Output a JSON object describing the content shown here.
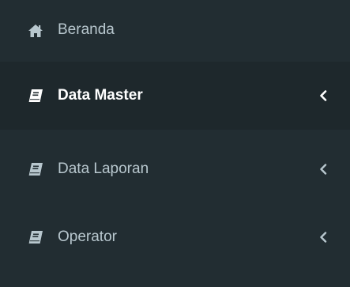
{
  "sidebar": {
    "items": [
      {
        "label": "Beranda",
        "icon": "home-icon",
        "active": false,
        "has_submenu": false
      },
      {
        "label": "Data Master",
        "icon": "book-icon",
        "active": true,
        "has_submenu": true
      },
      {
        "label": "Data Laporan",
        "icon": "book-icon",
        "active": false,
        "has_submenu": true
      },
      {
        "label": "Operator",
        "icon": "book-icon",
        "active": false,
        "has_submenu": true
      }
    ]
  },
  "colors": {
    "sidebar_bg": "#222d32",
    "active_bg": "#1e282c",
    "text": "#b8c7ce",
    "active_text": "#ffffff"
  }
}
